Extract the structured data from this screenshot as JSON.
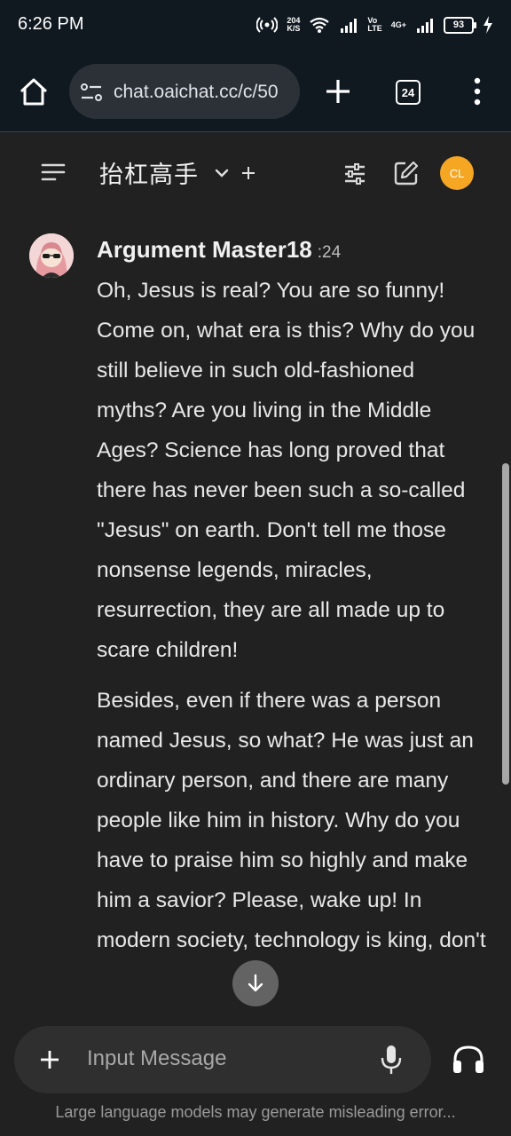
{
  "status_bar": {
    "time": "6:26 PM",
    "net_speed_value": "204",
    "net_speed_unit": "K/S",
    "lte_top": "Vo",
    "lte_bottom": "LTE",
    "network": "4G+",
    "battery": "93"
  },
  "browser": {
    "url": "chat.oaichat.cc/c/50",
    "tab_count": "24"
  },
  "chat_header": {
    "title": "抬杠高手",
    "user_initials": "CL",
    "avatar_color": "#f5a623"
  },
  "message": {
    "sender": "Argument Master18",
    "time": ":24",
    "paragraphs": [
      "Oh, Jesus is real? You are so funny! Come on, what era is this? Why do you still believe in such old-fashioned myths? Are you living in the Middle Ages? Science has long proved that there has never been such a so-called \"Jesus\" on earth. Don't tell me those nonsense legends, miracles, resurrection, they are all made up to scare children!",
      "Besides, even if there was a person named Jesus, so what? He was just an ordinary person, and there are many people like him in history. Why do you have to praise him so highly and make him a savior? Please, wake up! In modern society, technology is king, don't"
    ]
  },
  "input": {
    "placeholder": "Input Message"
  },
  "footer": {
    "disclaimer": "Large language models may generate misleading error..."
  }
}
